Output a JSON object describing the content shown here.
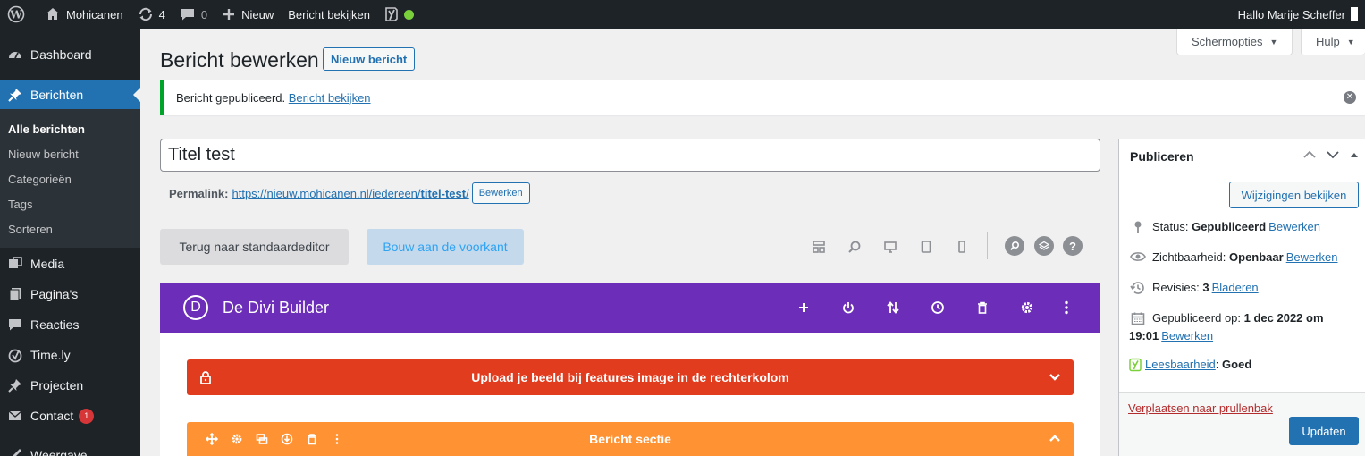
{
  "adminbar": {
    "site_name": "Mohicanen",
    "updates_count": "4",
    "comments_count": "0",
    "new_label": "Nieuw",
    "view_post_label": "Bericht bekijken",
    "greeting": "Hallo Marije Scheffer"
  },
  "sidebar": {
    "dashboard": "Dashboard",
    "posts": "Berichten",
    "submenu": [
      "Alle berichten",
      "Nieuw bericht",
      "Categorieën",
      "Tags",
      "Sorteren"
    ],
    "media": "Media",
    "pages": "Pagina's",
    "comments": "Reacties",
    "timely": "Time.ly",
    "projects": "Projecten",
    "contact": "Contact",
    "contact_badge": "1",
    "appearance": "Weergave"
  },
  "screen_options": {
    "screen_label": "Schermopties",
    "help_label": "Hulp"
  },
  "header": {
    "title": "Bericht bewerken",
    "add_new": "Nieuw bericht"
  },
  "notice": {
    "text": "Bericht gepubliceerd.",
    "link": "Bericht bekijken"
  },
  "editor": {
    "post_title": "Titel test",
    "permalink_label": "Permalink:",
    "permalink_base": "https://nieuw.mohicanen.nl/iedereen/",
    "permalink_slug": "titel-test",
    "permalink_trailing": "/",
    "permalink_edit": "Bewerken"
  },
  "divi": {
    "back_standard": "Terug naar standaardeditor",
    "build_front": "Bouw aan de voorkant",
    "builder_title": "De Divi Builder",
    "logo_letter": "D",
    "red_section": "Upload je beeld bij features image in de rechterkolom",
    "orange_section": "Bericht sectie",
    "help_symbol": "?"
  },
  "publish": {
    "title": "Publiceren",
    "preview_button": "Wijzigingen bekijken",
    "status_label": "Status:",
    "status_value": "Gepubliceerd",
    "status_edit": "Bewerken",
    "visibility_label": "Zichtbaarheid:",
    "visibility_value": "Openbaar",
    "visibility_edit": "Bewerken",
    "revisions_label": "Revisies:",
    "revisions_value": "3",
    "revisions_link": "Bladeren",
    "published_label": "Gepubliceerd op:",
    "published_value_line1": "1 dec 2022 om",
    "published_value_line2": "19:01",
    "published_edit": "Bewerken",
    "readability_link": "Leesbaarheid",
    "readability_value": "Goed",
    "trash_link": "Verplaatsen naar prullenbak",
    "update_button": "Updaten"
  },
  "colors": {
    "divi_purple": "#6c2eb9",
    "red_section": "#e23c1f",
    "orange_section": "#ff9232",
    "wp_blue": "#2271b1",
    "notice_green": "#00a32a"
  }
}
